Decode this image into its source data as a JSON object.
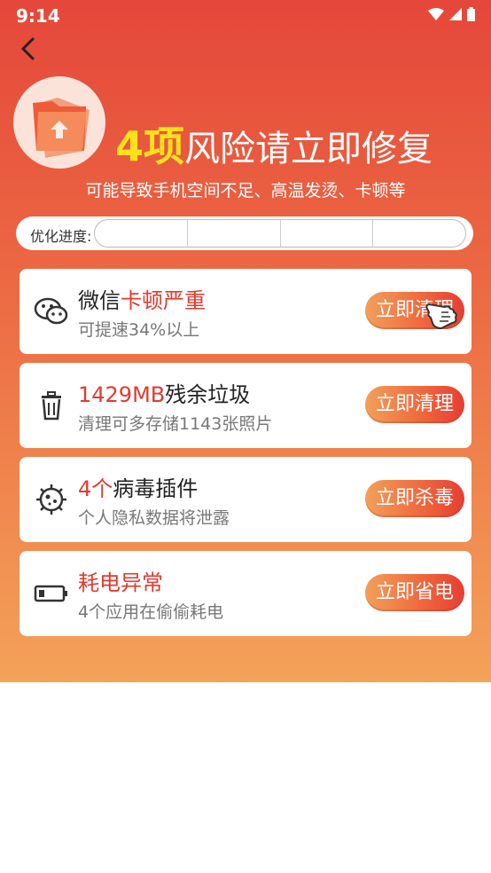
{
  "status_bar": {
    "time": "9:14"
  },
  "header": {
    "count": "4项",
    "title": "风险请立即修复",
    "subtitle": "可能导致手机空间不足、高温发烫、卡顿等"
  },
  "progress": {
    "label": "优化进度:",
    "value": 0
  },
  "cards": [
    {
      "title_black": "微信",
      "title_red": "卡顿严重",
      "subtitle": "可提速34%以上",
      "button": "立即清理",
      "icon": "wechat-icon"
    },
    {
      "title_red": "1429MB",
      "title_black": "残余垃圾",
      "subtitle": "清理可多存储1143张照片",
      "button": "立即清理",
      "icon": "trash-icon"
    },
    {
      "title_red": "4个",
      "title_black": "病毒插件",
      "subtitle": "个人隐私数据将泄露",
      "button": "立即杀毒",
      "icon": "virus-icon"
    },
    {
      "title_red": "耗电异常",
      "title_black": "",
      "subtitle": "4个应用在偷偷耗电",
      "button": "立即省电",
      "icon": "battery-icon"
    }
  ],
  "colors": {
    "accent_red": "#e23a2e",
    "highlight_yellow": "#ffe11b",
    "bg_top": "#e5473a",
    "bg_bottom": "#f4a259"
  }
}
